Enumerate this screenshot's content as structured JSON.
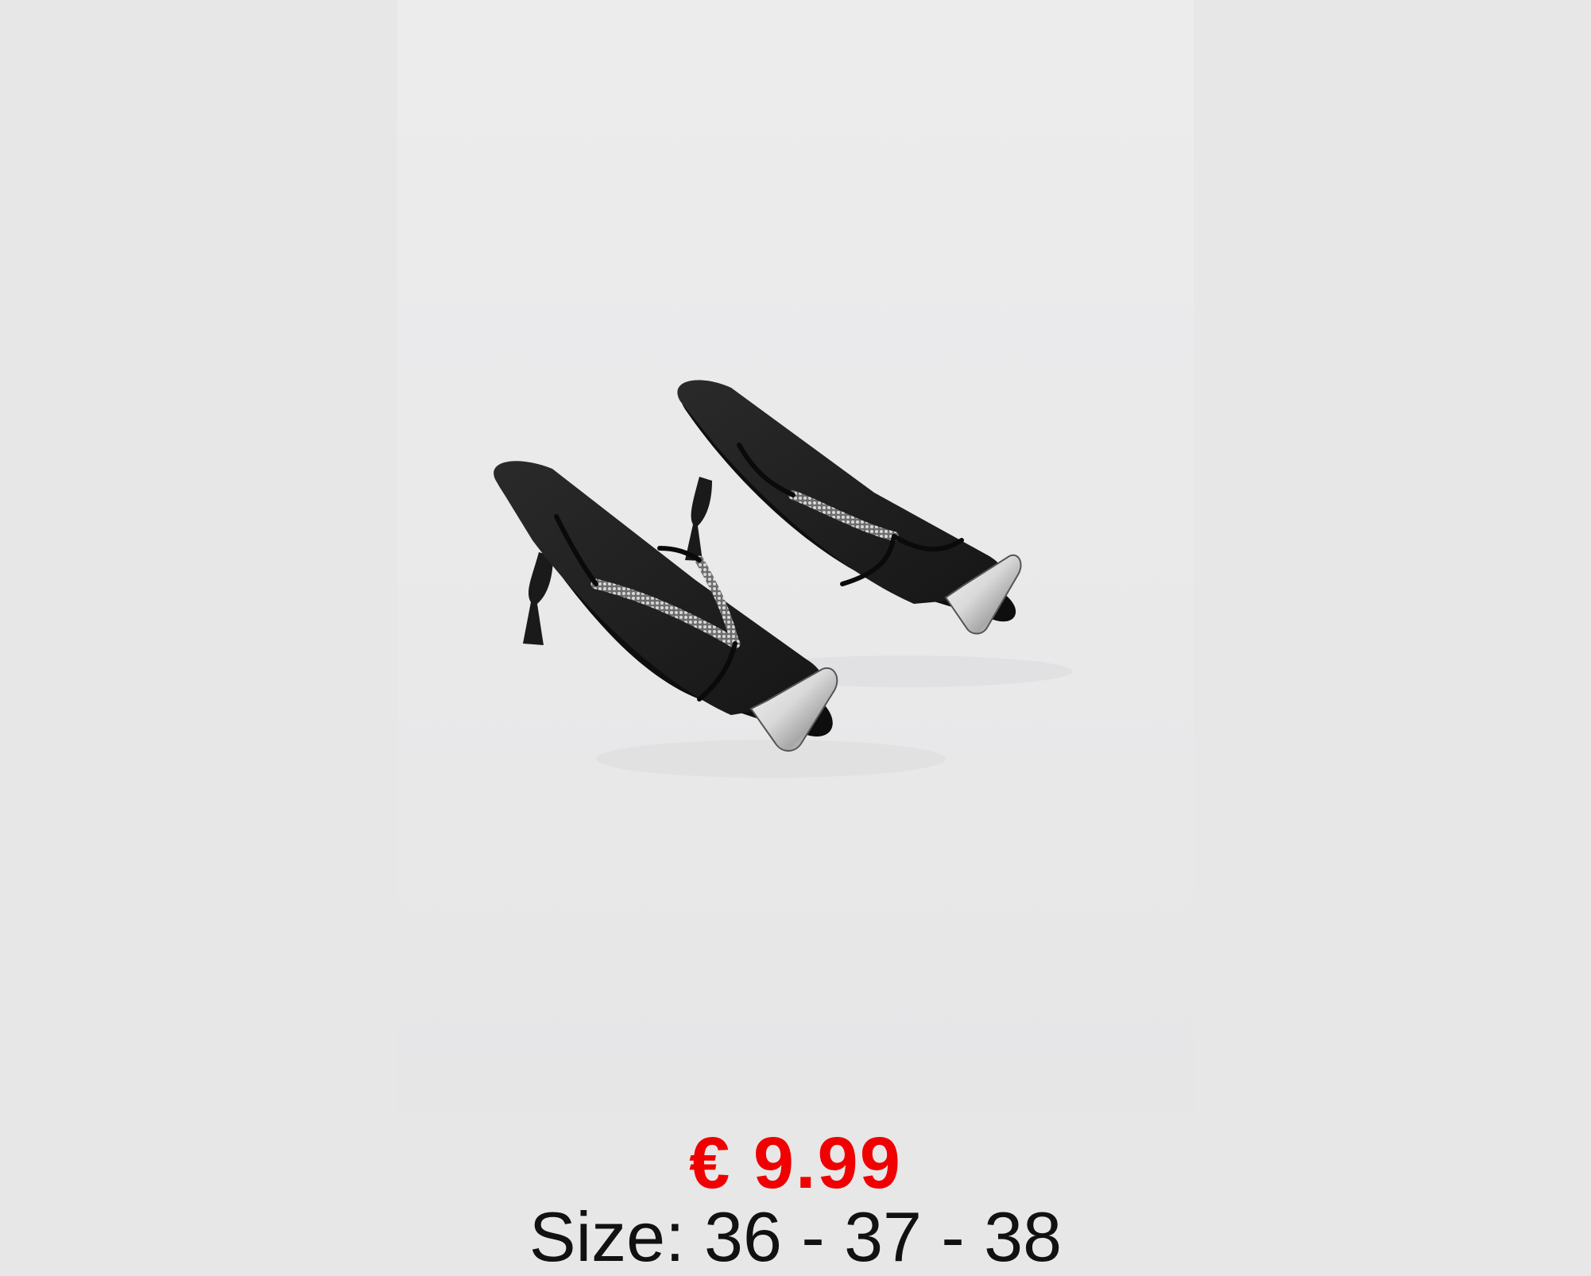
{
  "product": {
    "price": "€ 9.99",
    "size": "Size: 36 - 37 - 38",
    "colors": {
      "price": "#f00000",
      "text": "#111111",
      "page_background": "#e7e7e7",
      "photo_background": "#eaeaeb"
    }
  }
}
